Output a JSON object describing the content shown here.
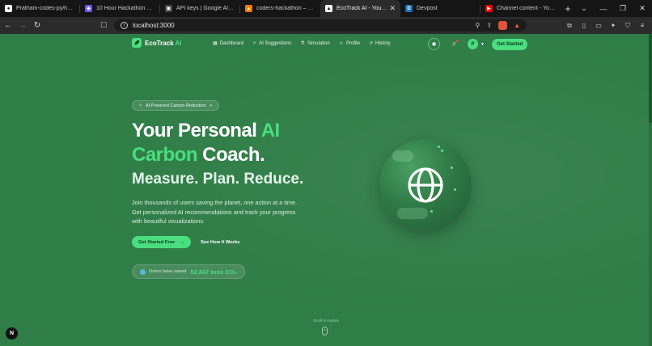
{
  "browser": {
    "tabs": [
      {
        "title": "Pratham-codes-py/hackth",
        "icon": "github-icon",
        "color": "#ffffff",
        "glyph": "⬤"
      },
      {
        "title": "10 Hour Hackathon Vibe C",
        "icon": "hackathon-icon",
        "color": "#6b5cff",
        "glyph": "◆"
      },
      {
        "title": "API keys | Google AI Studi",
        "icon": "ai-studio-icon",
        "color": "#444444",
        "glyph": "▣"
      },
      {
        "title": "coders-hackathon – Datab",
        "icon": "firebase-icon",
        "color": "#f57c00",
        "glyph": "▲"
      },
      {
        "title": "EcoTrack AI - Your Per",
        "icon": "vercel-icon",
        "color": "#ffffff",
        "glyph": "▲",
        "active": true
      },
      {
        "title": "Devpost",
        "icon": "devpost-icon",
        "color": "#1b73b9",
        "glyph": "D"
      },
      {
        "title": "Channel content - YouTub",
        "icon": "youtube-icon",
        "color": "#ff0000",
        "glyph": "▶"
      }
    ],
    "url": "localhost:3000",
    "notification_count": "2"
  },
  "nav": {
    "brand_main": "EcoTrack",
    "brand_accent": "AI",
    "links": [
      {
        "label": "Dashboard",
        "icon": "dashboard-icon",
        "glyph": "▦"
      },
      {
        "label": "AI Suggestions",
        "icon": "sparkle-icon",
        "glyph": "✧"
      },
      {
        "label": "Simulation",
        "icon": "flask-icon",
        "glyph": "⚗"
      },
      {
        "label": "Profile",
        "icon": "user-icon",
        "glyph": "☺"
      },
      {
        "label": "History",
        "icon": "history-icon",
        "glyph": "↺"
      }
    ],
    "avatar_initial": "P",
    "cta": "Get Started"
  },
  "hero": {
    "badge": "AI-Powered Carbon Reduction",
    "title_line1_a": "Your Personal ",
    "title_line1_b": "AI",
    "title_line2_a": "Carbon",
    "title_line2_b": " Coach.",
    "subtitle": "Measure. Plan. Reduce.",
    "description": "Join thousands of users saving the planet, one action at a time. Get personalized AI recommendations and track your progress with beautiful visualizations.",
    "primary_cta": "Get Started Free",
    "secondary_cta": "See How It Works",
    "stat_label": "Users have saved",
    "stat_value": "52,847 tons CO₂"
  },
  "scroll_hint": "Scroll to explore",
  "colors": {
    "page_bg": "#2f7d47",
    "accent": "#4ade80"
  }
}
